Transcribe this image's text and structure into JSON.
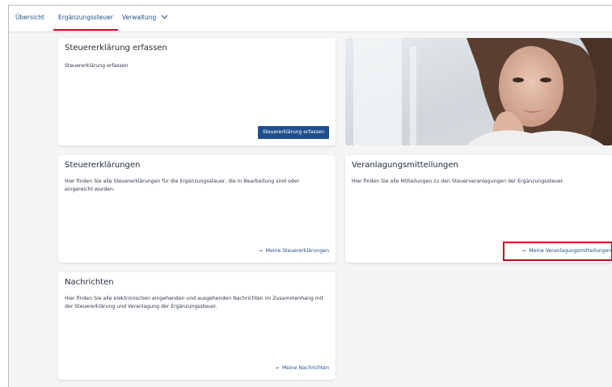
{
  "tabs": [
    {
      "label": "Übersicht"
    },
    {
      "label": "Ergänzungssteuer"
    },
    {
      "label": "Verwaltung"
    }
  ],
  "cards": {
    "capture": {
      "title": "Steuererklärung erfassen",
      "text": "Steuererklärung erfassen",
      "button": "Steuererklärung erfassen"
    },
    "returns": {
      "title": "Steuererklärungen",
      "text": "Hier finden Sie alle Steuererklärungen für die Ergänzungssteuer, die in Bearbeitung sind oder eingereicht wurden.",
      "link": "Meine Steuererklärungen"
    },
    "assessments": {
      "title": "Veranlagungsmitteilungen",
      "text": "Hier finden Sie alle Mitteilungen zu den Steuerveranlagungen der Ergänzungssteuer.",
      "link": "Meine Veranlagungsmitteilungen"
    },
    "messages": {
      "title": "Nachrichten",
      "text": "Hier finden Sie alle elektronischen eingehenden und ausgehenden Nachrichten im Zusammenhang mit der Steuererklärung und Veranlagung der Ergänzungssteuer.",
      "link": "Meine Nachrichten"
    }
  },
  "icons": {
    "link_arrow": "→",
    "dropdown": "chevron-down-icon"
  },
  "colors": {
    "accent": "#1f4e8c",
    "active_tab": "#d0021b",
    "highlight": "#d0021b"
  }
}
